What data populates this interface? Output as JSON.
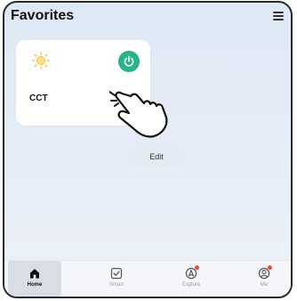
{
  "header": {
    "title": "Favorites"
  },
  "favorites": {
    "device": {
      "name": "CCT",
      "power_on": true,
      "accent": "#28b487",
      "icon": "sun-icon"
    }
  },
  "edit_label": "Edit",
  "tabs": [
    {
      "label": "Home",
      "icon": "home-icon",
      "active": true
    },
    {
      "label": "Smart",
      "icon": "smart-check-icon",
      "active": false
    },
    {
      "label": "Explore",
      "icon": "explore-compass-icon",
      "active": false,
      "notification_dot": true
    },
    {
      "label": "Me",
      "icon": "profile-icon",
      "active": false,
      "notification_dot": true
    }
  ]
}
